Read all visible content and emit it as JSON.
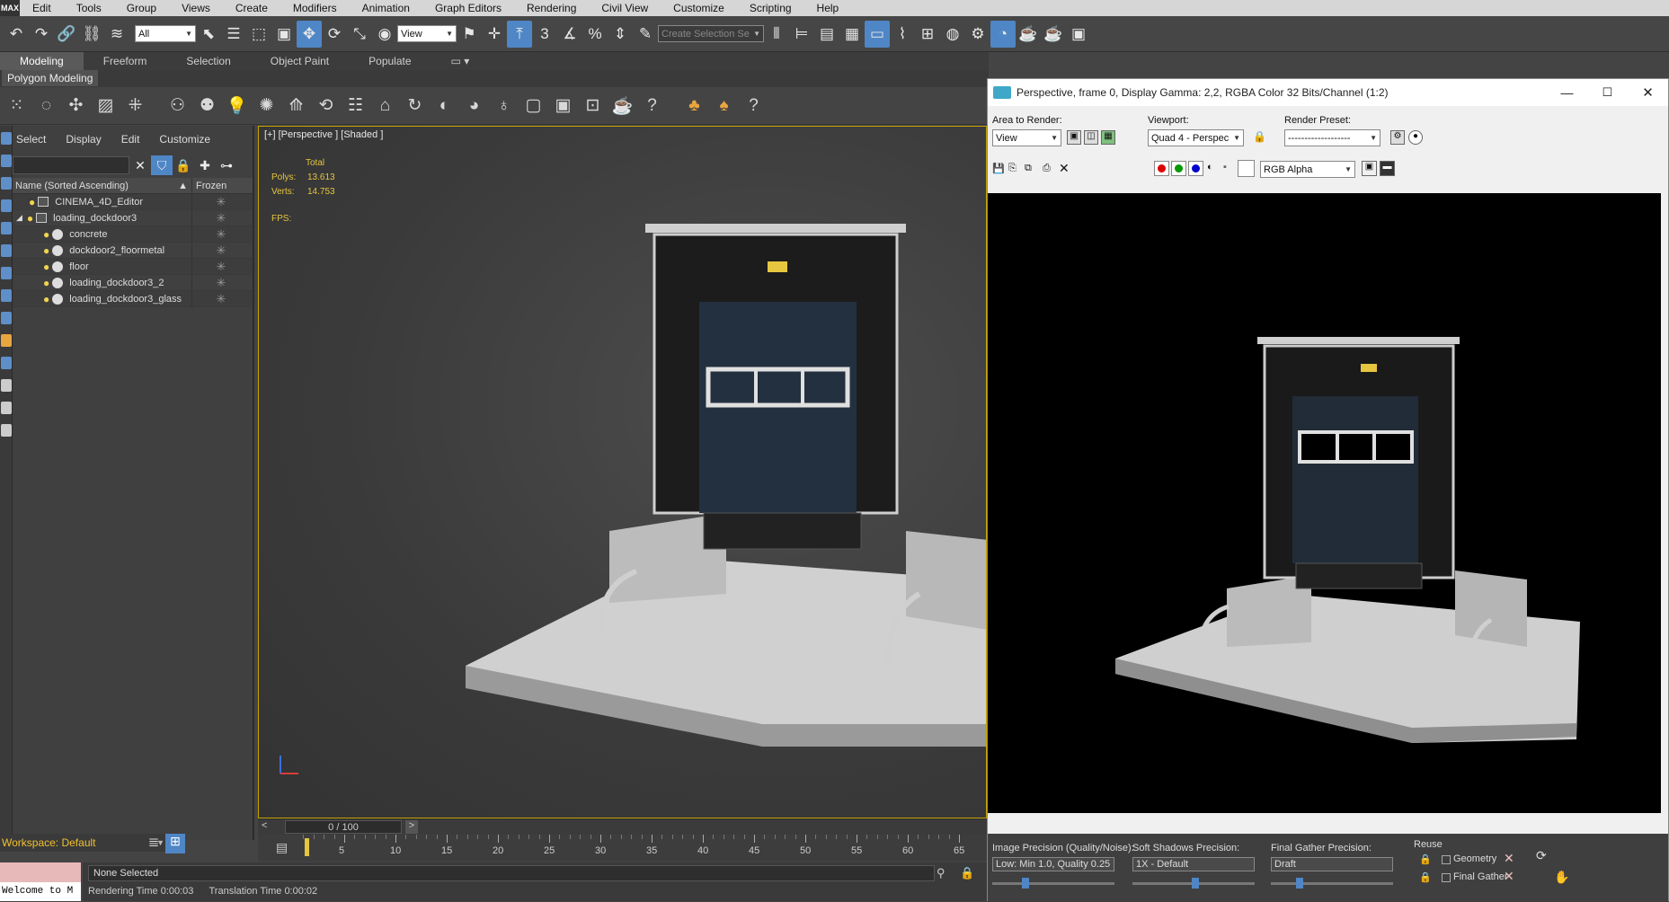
{
  "menu": {
    "logo": "MAX",
    "items": [
      "Edit",
      "Tools",
      "Group",
      "Views",
      "Create",
      "Modifiers",
      "Animation",
      "Graph Editors",
      "Rendering",
      "Civil View",
      "Customize",
      "Scripting",
      "Help"
    ]
  },
  "toolbar": {
    "selection_filter": "All",
    "ref_coord": "View",
    "named_selection_placeholder": "Create Selection Se"
  },
  "ribbon": {
    "tabs": [
      "Modeling",
      "Freeform",
      "Selection",
      "Object Paint",
      "Populate"
    ],
    "active_tab": "Modeling",
    "panel_label": "Polygon Modeling"
  },
  "scene_explorer": {
    "menu": [
      "Select",
      "Display",
      "Edit",
      "Customize"
    ],
    "col_name": "Name (Sorted Ascending)",
    "col_frozen": "Frozen",
    "rows": [
      {
        "name": "CINEMA_4D_Editor",
        "type": "camera",
        "indent": 0
      },
      {
        "name": "loading_dockdoor3",
        "type": "group",
        "indent": 0
      },
      {
        "name": "concrete",
        "type": "object",
        "indent": 1
      },
      {
        "name": "dockdoor2_floormetal",
        "type": "object",
        "indent": 1
      },
      {
        "name": "floor",
        "type": "object",
        "indent": 1
      },
      {
        "name": "loading_dockdoor3_2",
        "type": "object",
        "indent": 1
      },
      {
        "name": "loading_dockdoor3_glass",
        "type": "object",
        "indent": 1
      }
    ],
    "workspace": "Workspace: Default"
  },
  "viewport": {
    "label": "[+] [Perspective ] [Shaded ]",
    "total_label": "Total",
    "polys_label": "Polys:",
    "polys_value": "13.613",
    "verts_label": "Verts:",
    "verts_value": "14.753",
    "fps_label": "FPS:"
  },
  "timeline": {
    "frame_display": "0 / 100",
    "ticks": [
      "5",
      "10",
      "15",
      "20",
      "25",
      "30",
      "35",
      "40",
      "45",
      "50",
      "55",
      "60",
      "65"
    ]
  },
  "status": {
    "selection": "None Selected",
    "rendering_time": "Rendering Time  0:00:03",
    "translation_time": "Translation Time  0:00:02",
    "command_line": "Welcome to M"
  },
  "render_window": {
    "title": "Perspective, frame 0, Display Gamma: 2,2, RGBA Color 32 Bits/Channel (1:2)",
    "area_label": "Area to Render:",
    "area_value": "View",
    "viewport_label": "Viewport:",
    "viewport_value": "Quad 4 - Perspec",
    "preset_label": "Render Preset:",
    "preset_value": "-------------------",
    "channel_value": "RGB Alpha",
    "image_precision_label": "Image Precision (Quality/Noise):",
    "image_precision_value": "Low: Min 1.0, Quality 0.25",
    "soft_shadows_label": "Soft Shadows Precision:",
    "soft_shadows_value": "1X - Default",
    "final_gather_label": "Final Gather Precision:",
    "final_gather_value": "Draft",
    "reuse_label": "Reuse",
    "geometry_label": "Geometry",
    "final_gather_reuse_label": "Final Gather"
  },
  "colors": {
    "accent": "#4f86c6",
    "viewport_border": "#c7a300",
    "stats_yellow": "#e6c640"
  }
}
